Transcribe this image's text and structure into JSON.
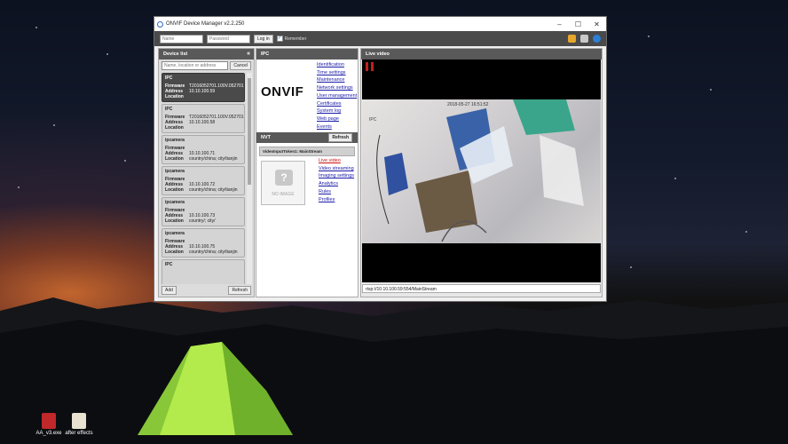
{
  "window": {
    "title": "ONVIF Device Manager v2.2.250"
  },
  "login": {
    "name_placeholder": "Name",
    "password_placeholder": "Password",
    "login_label": "Log in",
    "remember_label": "Remember"
  },
  "device_list": {
    "title": "Device list",
    "collapse_glyph": "«",
    "search_placeholder": "Name, location or address",
    "cancel_label": "Cancel",
    "add_label": "Add",
    "refresh_label": "Refresh",
    "field_labels": {
      "firmware": "Firmware",
      "address": "Address",
      "location": "Location"
    },
    "devices": [
      {
        "name": "IPC",
        "firmware": "T2016052701.100V.052701",
        "address": "10.10.100.59",
        "location": ""
      },
      {
        "name": "IPC",
        "firmware": "T2016052701.100V.052701",
        "address": "10.10.100.58",
        "location": ""
      },
      {
        "name": "ipcamera",
        "firmware": "",
        "address": "10.10.100.71",
        "location": "country/china; city/tianjin"
      },
      {
        "name": "ipcamera",
        "firmware": "",
        "address": "10.10.100.72",
        "location": "country/china; city/tianjin"
      },
      {
        "name": "ipcamera",
        "firmware": "",
        "address": "10.10.100.73",
        "location": "country/; city/"
      },
      {
        "name": "ipcamera",
        "firmware": "",
        "address": "10.10.100.75",
        "location": "country/china; city/tianjin"
      },
      {
        "name": "IPC"
      }
    ]
  },
  "ipc": {
    "title": "IPC",
    "logo_text": "ONVIF",
    "links": [
      "Identification",
      "Time settings",
      "Maintenance",
      "Network settings",
      "User management",
      "Certificates",
      "System log",
      "Web page",
      "Events"
    ],
    "nvt": {
      "title": "NVT",
      "refresh_label": "Refresh",
      "profile": "VideoInputToken1: MainStream",
      "no_image": "NO IMAGE",
      "links": [
        "Live video",
        "Video streaming",
        "Imaging settings",
        "Analytics",
        "Rules",
        "Profiles"
      ]
    }
  },
  "live_video": {
    "title": "Live video",
    "timestamp": "2018-05-27 16:51:52",
    "camera_label": "IPC",
    "url": "rtsp://10.10.100.59:554/MainStream"
  },
  "desktop_icons": [
    {
      "label": "AA_v3.exe"
    },
    {
      "label": "after effects"
    }
  ],
  "colors": {
    "accent_link": "#1a1aa8",
    "active_link": "#cc1111",
    "panel_header": "#595959",
    "pause_red": "#c21f1f"
  }
}
